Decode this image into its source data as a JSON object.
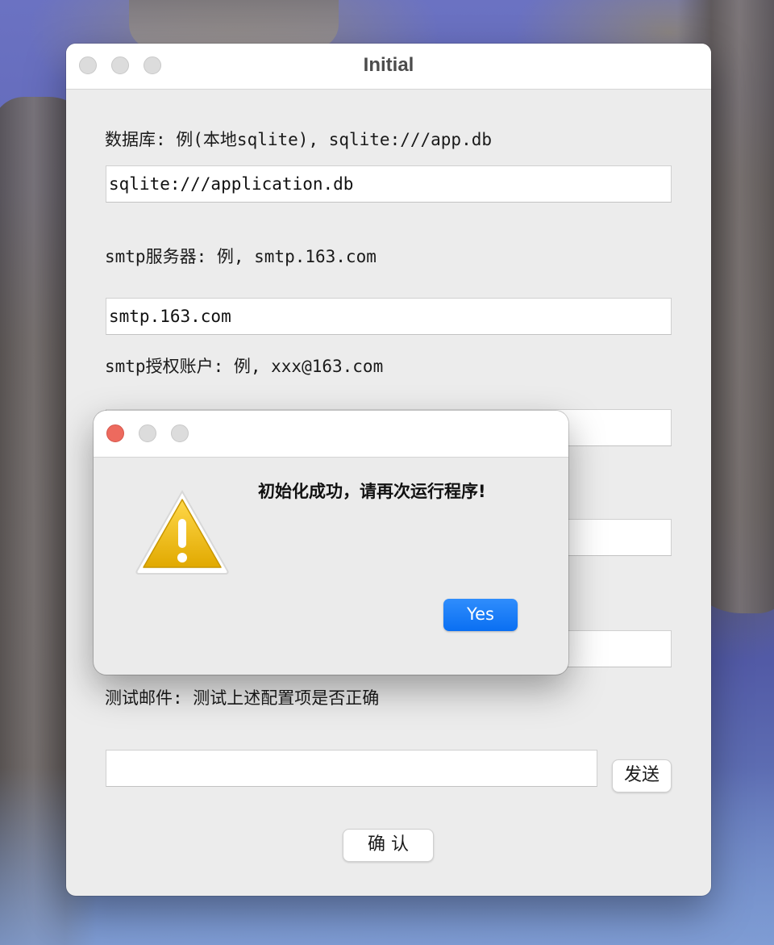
{
  "window": {
    "title": "Initial",
    "labels": {
      "database": "数据库: 例(本地sqlite), sqlite:///app.db",
      "smtp_server": "smtp服务器: 例, smtp.163.com",
      "smtp_account": "smtp授权账户: 例, xxx@163.com",
      "test_mail": "测试邮件: 测试上述配置项是否正确"
    },
    "fields": {
      "database_value": "sqlite:///application.db",
      "smtp_server_value": "smtp.163.com",
      "smtp_account_value": "",
      "field4_value": "",
      "field5_value": "",
      "test_mail_value": ""
    },
    "send_button": "发送",
    "confirm_button": "确 认"
  },
  "dialog": {
    "message": "初始化成功，请再次运行程序!",
    "yes_button": "Yes",
    "icon": "warning-icon"
  },
  "colors": {
    "close_red": "#ed6a5e",
    "yes_blue": "#1a7cf7",
    "warning_yellow": "#f2c200"
  }
}
